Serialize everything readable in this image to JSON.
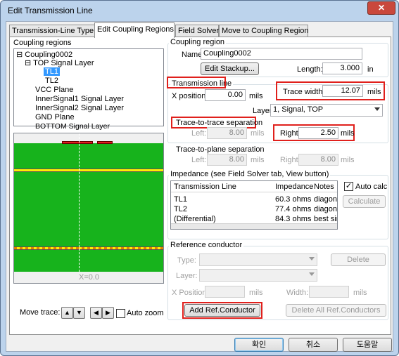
{
  "window": {
    "title": "Edit Transmission Line",
    "close_label": "✕"
  },
  "tabs": [
    {
      "label": "Transmission-Line Type"
    },
    {
      "label": "Edit Coupling Regions"
    },
    {
      "label": "Field Solver"
    },
    {
      "label": "Move to Coupling Region"
    }
  ],
  "coupling_regions": {
    "title": "Coupling regions",
    "items": [
      {
        "label": "Coupling0002",
        "toggle": "⊟"
      },
      {
        "label": "TOP Signal Layer",
        "toggle": "⊟"
      },
      {
        "label": "TL1",
        "selected": true
      },
      {
        "label": "TL2"
      },
      {
        "label": "VCC Plane"
      },
      {
        "label": "InnerSignal1 Signal Layer"
      },
      {
        "label": "InnerSignal2 Signal Layer"
      },
      {
        "label": "GND Plane"
      },
      {
        "label": "BOTTOM Signal Layer"
      }
    ]
  },
  "visual": {
    "x_readout": "X=0.0",
    "board_color": "#17b31c",
    "trace_color": "#e02020",
    "plane_color": "#ffee00"
  },
  "move_trace": {
    "label": "Move trace:",
    "up": "▲",
    "down": "▼",
    "left": "◀",
    "right": "▶",
    "auto_zoom": "Auto zoom"
  },
  "coupling_region": {
    "title": "Coupling region",
    "name_label": "Name:",
    "name_value": "Coupling0002",
    "edit_stackup": "Edit Stackup...",
    "length_label": "Length:",
    "length_value": "3.000",
    "length_unit": "in"
  },
  "transmission_line": {
    "title": "Transmission line",
    "x_position_label": "X position:",
    "x_position_value": "0.00",
    "x_unit": "mils",
    "trace_width_label": "Trace width:",
    "trace_width_value": "12.07",
    "trace_width_unit": "mils",
    "layer_label": "Layer",
    "layer_value": "1, Signal, TOP"
  },
  "trace_to_trace": {
    "title": "Trace-to-trace separation",
    "left_label": "Left:",
    "left_value": "8.00",
    "left_unit": "mils",
    "right_label": "Right:",
    "right_value": "2.50",
    "right_unit": "mils"
  },
  "trace_to_plane": {
    "title": "Trace-to-plane separation",
    "left_label": "Left:",
    "left_value": "8.00",
    "left_unit": "mils",
    "right_label": "Right:",
    "right_value": "8.00",
    "right_unit": "mils"
  },
  "impedance": {
    "title": "Impedance (see Field Solver tab, View button)",
    "columns": [
      "Transmission Line",
      "Impedance",
      "Notes"
    ],
    "rows": [
      {
        "line": "TL1",
        "impedance": "60.3 ohms",
        "notes": "diagona"
      },
      {
        "line": "TL2",
        "impedance": "77.4 ohms",
        "notes": "diagona"
      },
      {
        "line": "(Differential)",
        "impedance": "84.3 ohms",
        "notes": "best sing"
      }
    ],
    "auto_calc": "Auto calc",
    "auto_calc_checked": "✓",
    "calculate": "Calculate"
  },
  "reference_conductor": {
    "title": "Reference conductor",
    "type_label": "Type:",
    "layer_label": "Layer:",
    "x_position_label": "X Position:",
    "x_unit": "mils",
    "width_label": "Width:",
    "width_unit": "mils",
    "delete": "Delete",
    "add": "Add Ref.Conductor",
    "delete_all": "Delete All Ref.Conductors"
  },
  "footer": {
    "ok": "확인",
    "cancel": "취소",
    "help": "도움말"
  }
}
